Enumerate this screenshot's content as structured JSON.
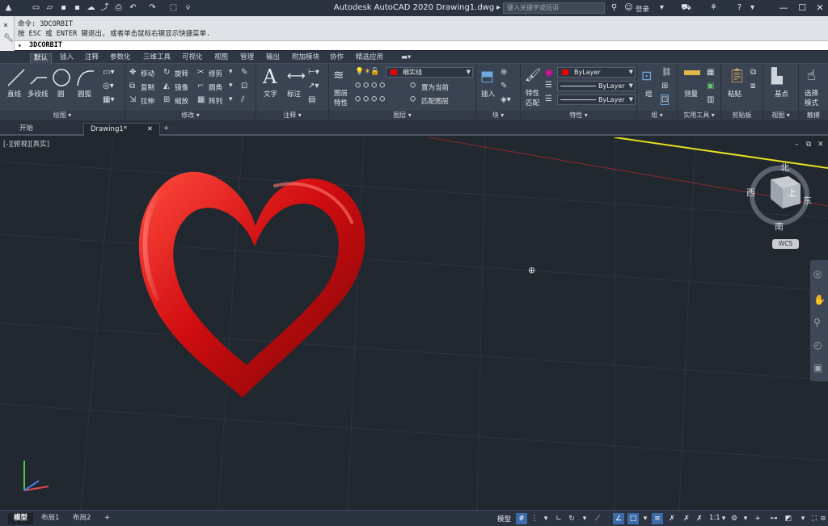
{
  "app": {
    "title": "Autodesk AutoCAD 2020    Drawing1.dwg",
    "search_placeholder": "键入关键字或短语",
    "login": "登录"
  },
  "command": {
    "history_1": "命令: 3DCORBIT",
    "history_2": "按 ESC 或 ENTER 键退出, 或者单击鼠标右键显示快捷菜单.",
    "current": "3DCORBIT"
  },
  "ribbon_tabs": [
    "默认",
    "插入",
    "注释",
    "参数化",
    "三维工具",
    "可视化",
    "视图",
    "管理",
    "输出",
    "附加模块",
    "协作",
    "精选应用"
  ],
  "draw": {
    "line": "直线",
    "polyline": "多段线",
    "circle": "圆",
    "arc": "圆弧",
    "title": "绘图 ▾"
  },
  "modify": {
    "move": "移动",
    "rotate": "旋转",
    "trim": "修剪",
    "copy": "复制",
    "mirror": "镜像",
    "fillet": "圆角",
    "stretch": "拉伸",
    "scale": "缩放",
    "array": "阵列",
    "title": "修改 ▾"
  },
  "annotation": {
    "text": "文字",
    "dimension": "标注",
    "title": "注释 ▾"
  },
  "layers": {
    "properties": "图层\n特性",
    "properties_l1": "图层",
    "properties_l2": "特性",
    "current_layer": "细实线",
    "set_current": "置为当前",
    "match_layer": "匹配图层",
    "title": "图层 ▾"
  },
  "block": {
    "insert": "插入",
    "title": "块 ▾"
  },
  "properties": {
    "match_l1": "特性",
    "match_l2": "匹配",
    "color": "ByLayer",
    "linetype": "ByLayer",
    "lineweight": "ByLayer",
    "title": "特性 ▾",
    "color_hex": "#e00000"
  },
  "groups": {
    "group": "组",
    "title": "组 ▾"
  },
  "utilities": {
    "measure": "测量",
    "title": "实用工具 ▾"
  },
  "clipboard": {
    "paste": "粘贴",
    "title": "剪贴板"
  },
  "view": {
    "base": "基点",
    "title": "视图 ▾"
  },
  "touch": {
    "select_l1": "选择",
    "select_l2": "模式",
    "title": "触摸"
  },
  "file_tabs": [
    "开始",
    "Drawing1*"
  ],
  "viewport": {
    "label": "[-][俯视][真实]"
  },
  "viewcube": {
    "north": "北",
    "south": "南",
    "east": "东",
    "west": "西",
    "top": "上",
    "wcs": "WCS"
  },
  "layout_tabs": [
    "模型",
    "布局1",
    "布局2"
  ],
  "status": {
    "model": "模型",
    "scale": "1:1"
  },
  "colors": {
    "heart": "#d10d10",
    "canvas": "#212830",
    "ribbon": "#3a4351"
  }
}
